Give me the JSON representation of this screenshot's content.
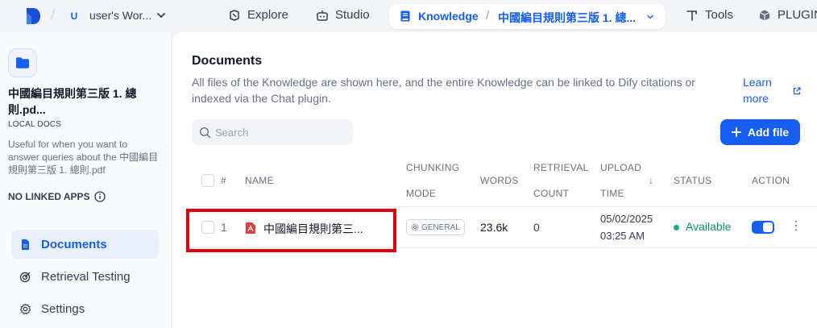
{
  "topbar": {
    "workspace_initial": "U",
    "workspace_name": "user's Wor...",
    "nav": {
      "explore": "Explore",
      "studio": "Studio",
      "knowledge": "Knowledge",
      "current_doc": "中國編目規則第三版 1. 總...",
      "tools": "Tools",
      "plugins": "PLUGIN"
    }
  },
  "sidebar": {
    "kb_title": "中國編目規則第三版 1. 總則.pd...",
    "kb_type": "LOCAL DOCS",
    "kb_description": "Useful for when you want to answer queries about the 中國編目規則第三版 1. 總則.pdf",
    "linked_apps": "NO LINKED APPS",
    "items": [
      {
        "label": "Documents",
        "icon": "document-icon",
        "active": true
      },
      {
        "label": "Retrieval Testing",
        "icon": "target-icon",
        "active": false
      },
      {
        "label": "Settings",
        "icon": "gear-icon",
        "active": false
      }
    ]
  },
  "main": {
    "title": "Documents",
    "description": "All files of the Knowledge are shown here, and the entire Knowledge can be linked to Dify citations or indexed via the Chat plugin.",
    "learn_more": "Learn more",
    "search_placeholder": "Search",
    "add_file": "Add file",
    "columns": {
      "index": "#",
      "name": "NAME",
      "chunking_1": "CHUNKING",
      "chunking_2": "MODE",
      "words": "WORDS",
      "retrieval_1": "RETRIEVAL",
      "retrieval_2": "COUNT",
      "upload_1": "UPLOAD",
      "upload_2": "TIME",
      "sort_arrow": "↓",
      "status": "STATUS",
      "action": "ACTION"
    },
    "rows": [
      {
        "index": "1",
        "name": "中國編目規則第三...",
        "chunking_mode": "GENERAL",
        "words": "23.6k",
        "retrieval_count": "0",
        "upload_date": "05/02/2025",
        "upload_time": "03:25 AM",
        "status": "Available",
        "enabled": true
      }
    ]
  },
  "colors": {
    "accent": "#155eef",
    "status_available": "#17b26a",
    "highlight_border": "#e2000f",
    "pdf_red": "#e33d3d"
  }
}
